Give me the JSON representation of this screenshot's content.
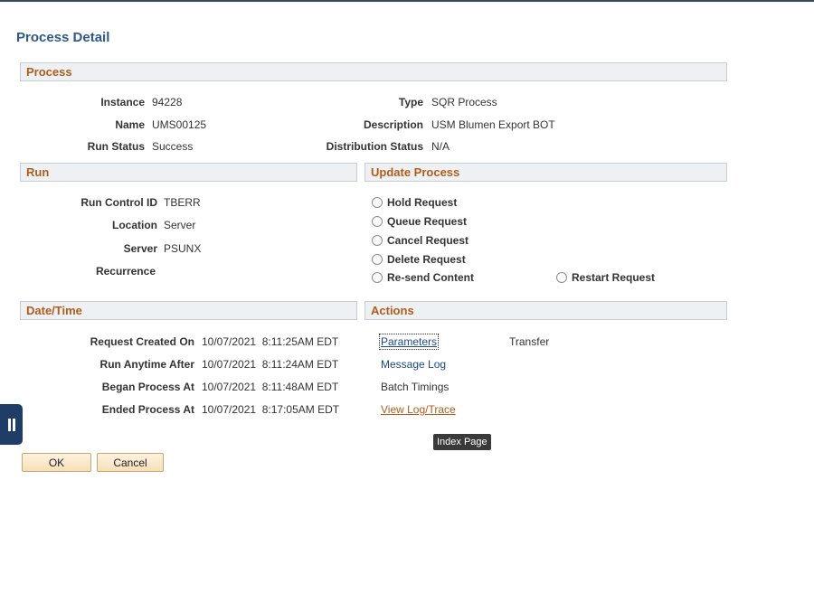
{
  "page_title": "Process Detail",
  "process": {
    "header": "Process",
    "instance_label": "Instance",
    "instance_value": "94228",
    "name_label": "Name",
    "name_value": "UMS00125",
    "run_status_label": "Run Status",
    "run_status_value": "Success",
    "type_label": "Type",
    "type_value": "SQR Process",
    "description_label": "Description",
    "description_value": "USM Blumen Export BOT",
    "distribution_status_label": "Distribution Status",
    "distribution_status_value": "N/A"
  },
  "run": {
    "header": "Run",
    "run_control_id_label": "Run Control ID",
    "run_control_id_value": "TBERR",
    "location_label": "Location",
    "location_value": "Server",
    "server_label": "Server",
    "server_value": "PSUNX",
    "recurrence_label": "Recurrence",
    "recurrence_value": ""
  },
  "update_process": {
    "header": "Update Process",
    "options": [
      "Hold Request",
      "Queue Request",
      "Cancel Request",
      "Delete Request",
      "Re-send Content",
      "Restart Request"
    ]
  },
  "datetime": {
    "header": "Date/Time",
    "request_created_label": "Request Created On",
    "request_created_value": "10/07/2021  8:11:25AM EDT",
    "run_anytime_label": "Run Anytime After",
    "run_anytime_value": "10/07/2021  8:11:24AM EDT",
    "began_label": "Began Process At",
    "began_value": "10/07/2021  8:11:48AM EDT",
    "ended_label": "Ended Process At",
    "ended_value": "10/07/2021  8:17:05AM EDT"
  },
  "actions": {
    "header": "Actions",
    "parameters": "Parameters",
    "transfer": "Transfer",
    "message_log": "Message Log",
    "batch_timings": "Batch Timings",
    "view_log_trace": "View Log/Trace"
  },
  "tooltip": "Index Page",
  "buttons": {
    "ok": "OK",
    "cancel": "Cancel"
  },
  "colors": {
    "section_header_text": "#b15c1a",
    "link": "#1a4a8a",
    "title": "#2e5a87",
    "handle": "#1f3d66"
  }
}
